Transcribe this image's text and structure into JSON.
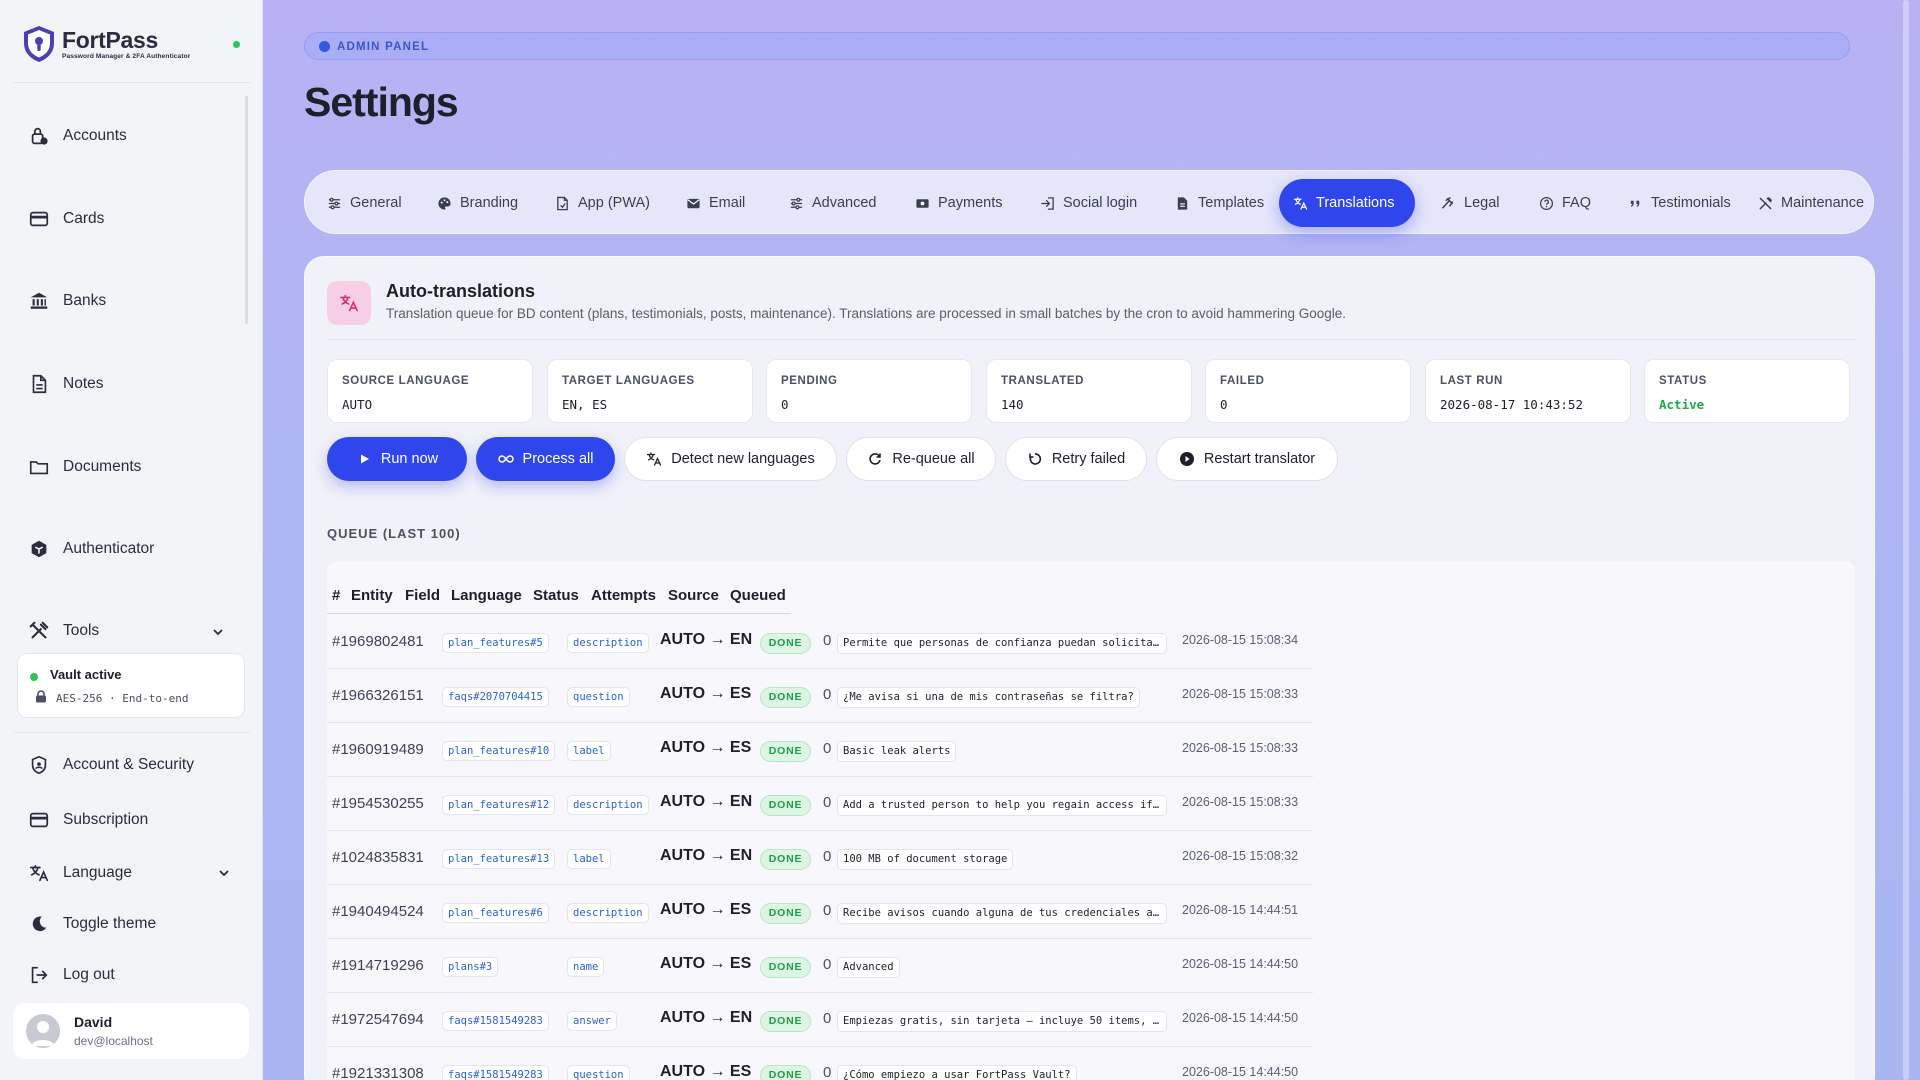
{
  "brand": {
    "name": "FortPass",
    "tagline": "Password Manager & 2FA Authenticator"
  },
  "sidebar": {
    "items": [
      {
        "label": "Accounts",
        "icon": "lock-icon"
      },
      {
        "label": "Cards",
        "icon": "card-icon"
      },
      {
        "label": "Banks",
        "icon": "bank-icon"
      },
      {
        "label": "Notes",
        "icon": "note-icon"
      },
      {
        "label": "Documents",
        "icon": "folder-icon"
      },
      {
        "label": "Authenticator",
        "icon": "cube-icon"
      },
      {
        "label": "Tools",
        "icon": "tools-icon"
      }
    ],
    "vault": {
      "title": "Vault active",
      "subtitle": "AES-256 · End-to-end"
    },
    "bottom": [
      {
        "label": "Account & Security",
        "icon": "shield-icon"
      },
      {
        "label": "Subscription",
        "icon": "card-icon"
      },
      {
        "label": "Language",
        "icon": "translate-icon"
      },
      {
        "label": "Toggle theme",
        "icon": "moon-icon"
      },
      {
        "label": "Log out",
        "icon": "logout-icon"
      }
    ],
    "user": {
      "name": "David",
      "email": "dev@localhost"
    }
  },
  "header": {
    "badge": "ADMIN PANEL",
    "title": "Settings"
  },
  "tabs": [
    {
      "label": "General",
      "icon": "sliders-icon"
    },
    {
      "label": "Branding",
      "icon": "palette-icon"
    },
    {
      "label": "App (PWA)",
      "icon": "app-icon"
    },
    {
      "label": "Email",
      "icon": "mail-icon"
    },
    {
      "label": "Advanced",
      "icon": "sliders-icon"
    },
    {
      "label": "Payments",
      "icon": "cash-icon"
    },
    {
      "label": "Social login",
      "icon": "login-icon"
    },
    {
      "label": "Templates",
      "icon": "file-icon"
    },
    {
      "label": "Translations",
      "icon": "translate-icon",
      "active": true
    },
    {
      "label": "Legal",
      "icon": "gavel-icon"
    },
    {
      "label": "FAQ",
      "icon": "help-icon"
    },
    {
      "label": "Testimonials",
      "icon": "quote-icon"
    },
    {
      "label": "Maintenance",
      "icon": "wrench-icon"
    }
  ],
  "panel": {
    "title": "Auto-translations",
    "description": "Translation queue for BD content (plans, testimonials, posts, maintenance). Translations are processed in small batches by the cron to avoid hammering Google.",
    "stats": [
      {
        "label": "SOURCE LANGUAGE",
        "value": "AUTO"
      },
      {
        "label": "TARGET LANGUAGES",
        "value": "EN, ES"
      },
      {
        "label": "PENDING",
        "value": "0"
      },
      {
        "label": "TRANSLATED",
        "value": "140"
      },
      {
        "label": "FAILED",
        "value": "0"
      },
      {
        "label": "LAST RUN",
        "value": "2026-08-17 10:43:52"
      },
      {
        "label": "STATUS",
        "value": "Active"
      }
    ],
    "buttons": [
      {
        "label": "Run now",
        "icon": "play-icon"
      },
      {
        "label": "Process all",
        "icon": "infinity-icon"
      },
      {
        "label": "Detect new languages",
        "icon": "translate-icon"
      },
      {
        "label": "Re-queue all",
        "icon": "refresh-icon"
      },
      {
        "label": "Retry failed",
        "icon": "retry-icon"
      },
      {
        "label": "Restart translator",
        "icon": "play-circle-icon"
      }
    ],
    "queue_label": "QUEUE (LAST 100)",
    "columns": [
      "#",
      "Entity",
      "Field",
      "Language",
      "Status",
      "Attempts",
      "Source",
      "Queued"
    ],
    "rows": [
      {
        "id": "#1969802481",
        "entity": "plan_features#5",
        "field": "description",
        "lang": "AUTO → EN",
        "status": "DONE",
        "attempts": "0",
        "source": "Permite que personas de confianza puedan solicita...",
        "queued": "2026-08-15 15:08:34"
      },
      {
        "id": "#1966326151",
        "entity": "faqs#2070704415",
        "field": "question",
        "lang": "AUTO → ES",
        "status": "DONE",
        "attempts": "0",
        "source": "¿Me avisa si una de mis contraseñas se filtra?",
        "queued": "2026-08-15 15:08:33"
      },
      {
        "id": "#1960919489",
        "entity": "plan_features#10",
        "field": "label",
        "lang": "AUTO → ES",
        "status": "DONE",
        "attempts": "0",
        "source": "Basic leak alerts",
        "queued": "2026-08-15 15:08:33"
      },
      {
        "id": "#1954530255",
        "entity": "plan_features#12",
        "field": "description",
        "lang": "AUTO → EN",
        "status": "DONE",
        "attempts": "0",
        "source": "Add a trusted person to help you regain access if...",
        "queued": "2026-08-15 15:08:33"
      },
      {
        "id": "#1024835831",
        "entity": "plan_features#13",
        "field": "label",
        "lang": "AUTO → EN",
        "status": "DONE",
        "attempts": "0",
        "source": "100 MB of document storage",
        "queued": "2026-08-15 15:08:32"
      },
      {
        "id": "#1940494524",
        "entity": "plan_features#6",
        "field": "description",
        "lang": "AUTO → ES",
        "status": "DONE",
        "attempts": "0",
        "source": "Recibe avisos cuando alguna de tus credenciales a...",
        "queued": "2026-08-15 14:44:51"
      },
      {
        "id": "#1914719296",
        "entity": "plans#3",
        "field": "name",
        "lang": "AUTO → ES",
        "status": "DONE",
        "attempts": "0",
        "source": "Advanced",
        "queued": "2026-08-15 14:44:50"
      },
      {
        "id": "#1972547694",
        "entity": "faqs#1581549283",
        "field": "answer",
        "lang": "AUTO → EN",
        "status": "DONE",
        "attempts": "0",
        "source": "Empiezas gratis, sin tarjeta — incluye 50 items, ...",
        "queued": "2026-08-15 14:44:50"
      },
      {
        "id": "#1921331308",
        "entity": "faqs#1581549283",
        "field": "question",
        "lang": "AUTO → ES",
        "status": "DONE",
        "attempts": "0",
        "source": "¿Cómo empiezo a usar FortPass Vault?",
        "queued": "2026-08-15 14:44:50"
      }
    ]
  },
  "colors": {
    "accent": "#2e46ec",
    "success": "#22a84b",
    "background": "#b8b2f4"
  }
}
